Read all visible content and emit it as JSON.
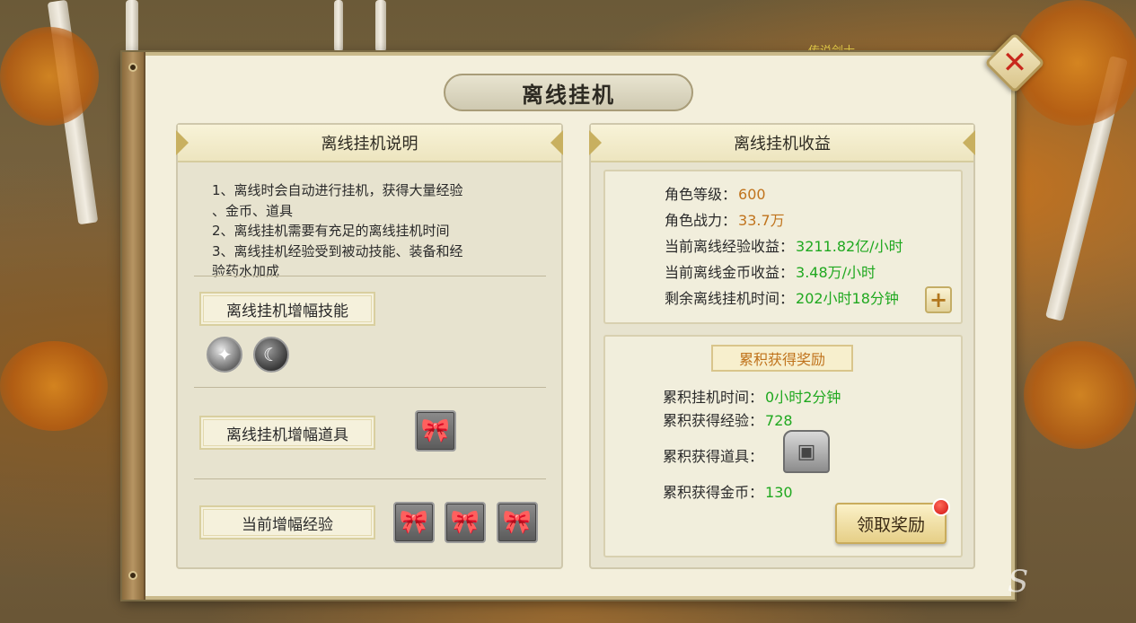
{
  "scene": {
    "npc_name": "传说剑士"
  },
  "window": {
    "title": "离线挂机"
  },
  "left": {
    "header": "离线挂机说明",
    "desc_lines": [
      "1、离线时会自动进行挂机，获得大量经验",
      "、金币、道具",
      "2、离线挂机需要有充足的离线挂机时间",
      "3、离线挂机经验受到被动技能、装备和经",
      "验药水加成"
    ],
    "skill_label": "离线挂机增幅技能",
    "item_label": "离线挂机增幅道具",
    "exp_label": "当前增幅经验",
    "skill_icons": [
      "wind-skill-icon",
      "wolf-skill-icon"
    ],
    "item_icons": [
      "ribbon-item-icon"
    ],
    "exp_icons": [
      "ribbon-item-icon",
      "ribbon-item-icon",
      "ribbon-item-icon"
    ]
  },
  "right": {
    "header": "离线挂机收益",
    "stats": [
      {
        "label": "角色等级：",
        "value": "600",
        "color": "#c0731c"
      },
      {
        "label": "角色战力：",
        "value": "33.7万",
        "color": "#c0731c"
      },
      {
        "label": "当前离线经验收益：",
        "value": "3211.82亿/小时",
        "color": "#1fa81f"
      },
      {
        "label": "当前离线金币收益：",
        "value": "3.48万/小时",
        "color": "#1fa81f"
      },
      {
        "label": "剩余离线挂机时间：",
        "value": "202小时18分钟",
        "color": "#1fa81f"
      }
    ],
    "reward_title": "累积获得奖励",
    "rewards": {
      "time_label": "累积挂机时间：",
      "time_value": "0小时2分钟",
      "exp_label": "累积获得经验：",
      "exp_value": "728",
      "item_label": "累积获得道具：",
      "gold_label": "累积获得金币：",
      "gold_value": "130"
    },
    "claim_button": "领取奖励"
  }
}
